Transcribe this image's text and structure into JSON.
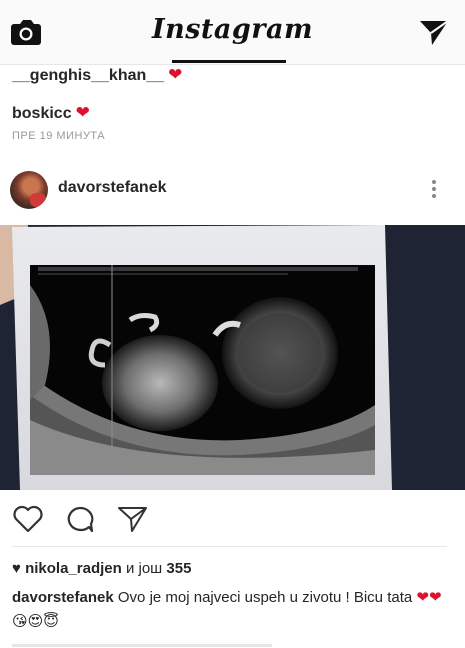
{
  "header": {
    "logo_text": "Instagram",
    "camera_icon": "camera-icon",
    "direct_icon": "direct-message-icon"
  },
  "previous_post": {
    "comments": [
      {
        "username": "__genghis__khan__",
        "emoji": "❤"
      },
      {
        "username": "boskicc",
        "emoji": "❤"
      }
    ],
    "time_ago": "ПРЕ 19 МИНУТА"
  },
  "post": {
    "username": "davorstefanek",
    "more_icon": "more-options-icon",
    "image_alt": "ultrasound photo",
    "likes": {
      "icon": "heart-icon",
      "first_user": "nikola_radjen",
      "connector": "и још",
      "count": "355"
    },
    "caption": {
      "username": "davorstefanek",
      "text": "Ovo je moj najveci uspeh u zivotu ! Bicu tata",
      "emojis": [
        "❤",
        "❤",
        "😘",
        "😍",
        "😇"
      ]
    }
  },
  "colors": {
    "heart": "#e0102d",
    "text": "#262626",
    "muted": "#999999"
  }
}
